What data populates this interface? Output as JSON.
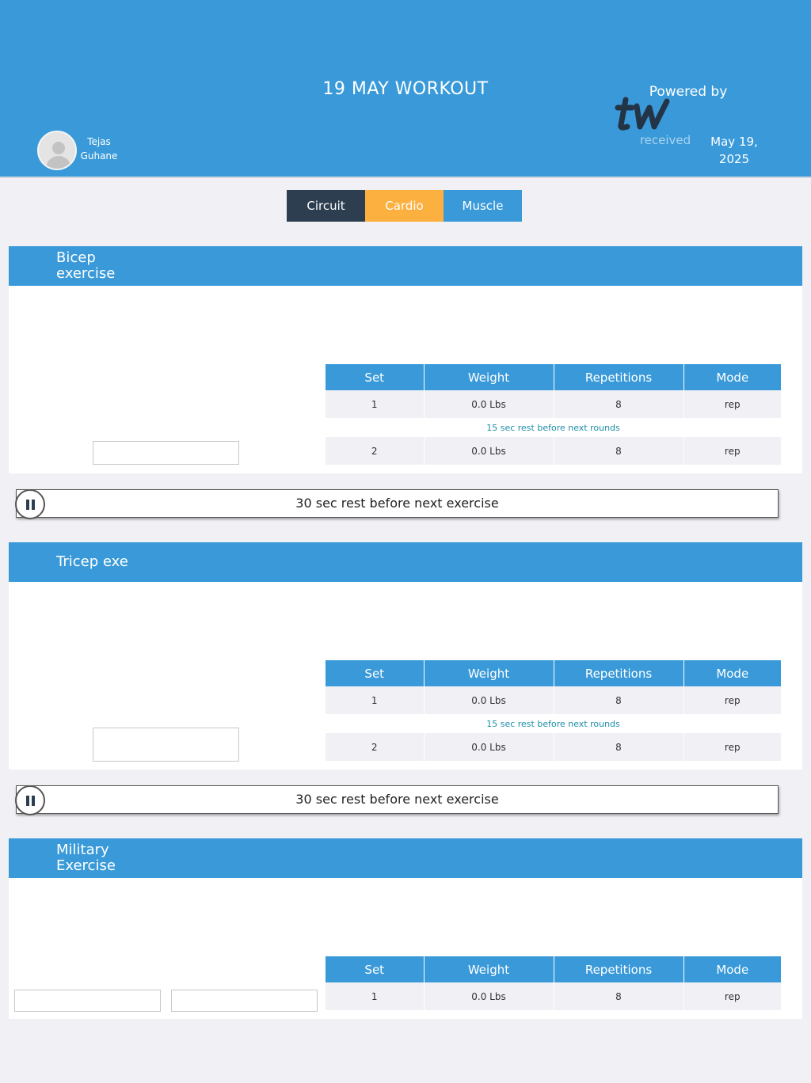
{
  "header": {
    "title": "19 MAY WORKOUT",
    "user_first": "Tejas",
    "user_last": "Guhane",
    "powered_by": "Powered by",
    "received_label": "received",
    "date_line1": "May 19,",
    "date_line2": "2025"
  },
  "tabs": [
    "Circuit",
    "Cardio",
    "Muscle"
  ],
  "table_headers": [
    "Set",
    "Weight",
    "Repetitions",
    "Mode"
  ],
  "exercises": [
    {
      "name": "Bicep exercise",
      "set1": {
        "set": "1",
        "weight": "0.0 Lbs",
        "reps": "8",
        "mode": "rep"
      },
      "round_rest": "15 sec rest before next rounds",
      "set2": {
        "set": "2",
        "weight": "0.0 Lbs",
        "reps": "8",
        "mode": "rep"
      },
      "exercise_rest": "30 sec rest before next exercise"
    },
    {
      "name": "Tricep exe",
      "set1": {
        "set": "1",
        "weight": "0.0 Lbs",
        "reps": "8",
        "mode": "rep"
      },
      "round_rest": "15 sec rest before next rounds",
      "set2": {
        "set": "2",
        "weight": "0.0 Lbs",
        "reps": "8",
        "mode": "rep"
      },
      "exercise_rest": "30 sec rest before next exercise"
    },
    {
      "name": "Military Exercise",
      "set1": {
        "set": "1",
        "weight": "0.0 Lbs",
        "reps": "8",
        "mode": "rep"
      }
    }
  ],
  "colors": {
    "primary": "#3a9ad9",
    "dark_tab": "#2c3e50",
    "accent_tab": "#fbb040",
    "rest_text": "#1d8ea8",
    "background": "#f0f0f5"
  },
  "icons": [
    "user-avatar-icon",
    "tw-logo",
    "pause-icon"
  ]
}
